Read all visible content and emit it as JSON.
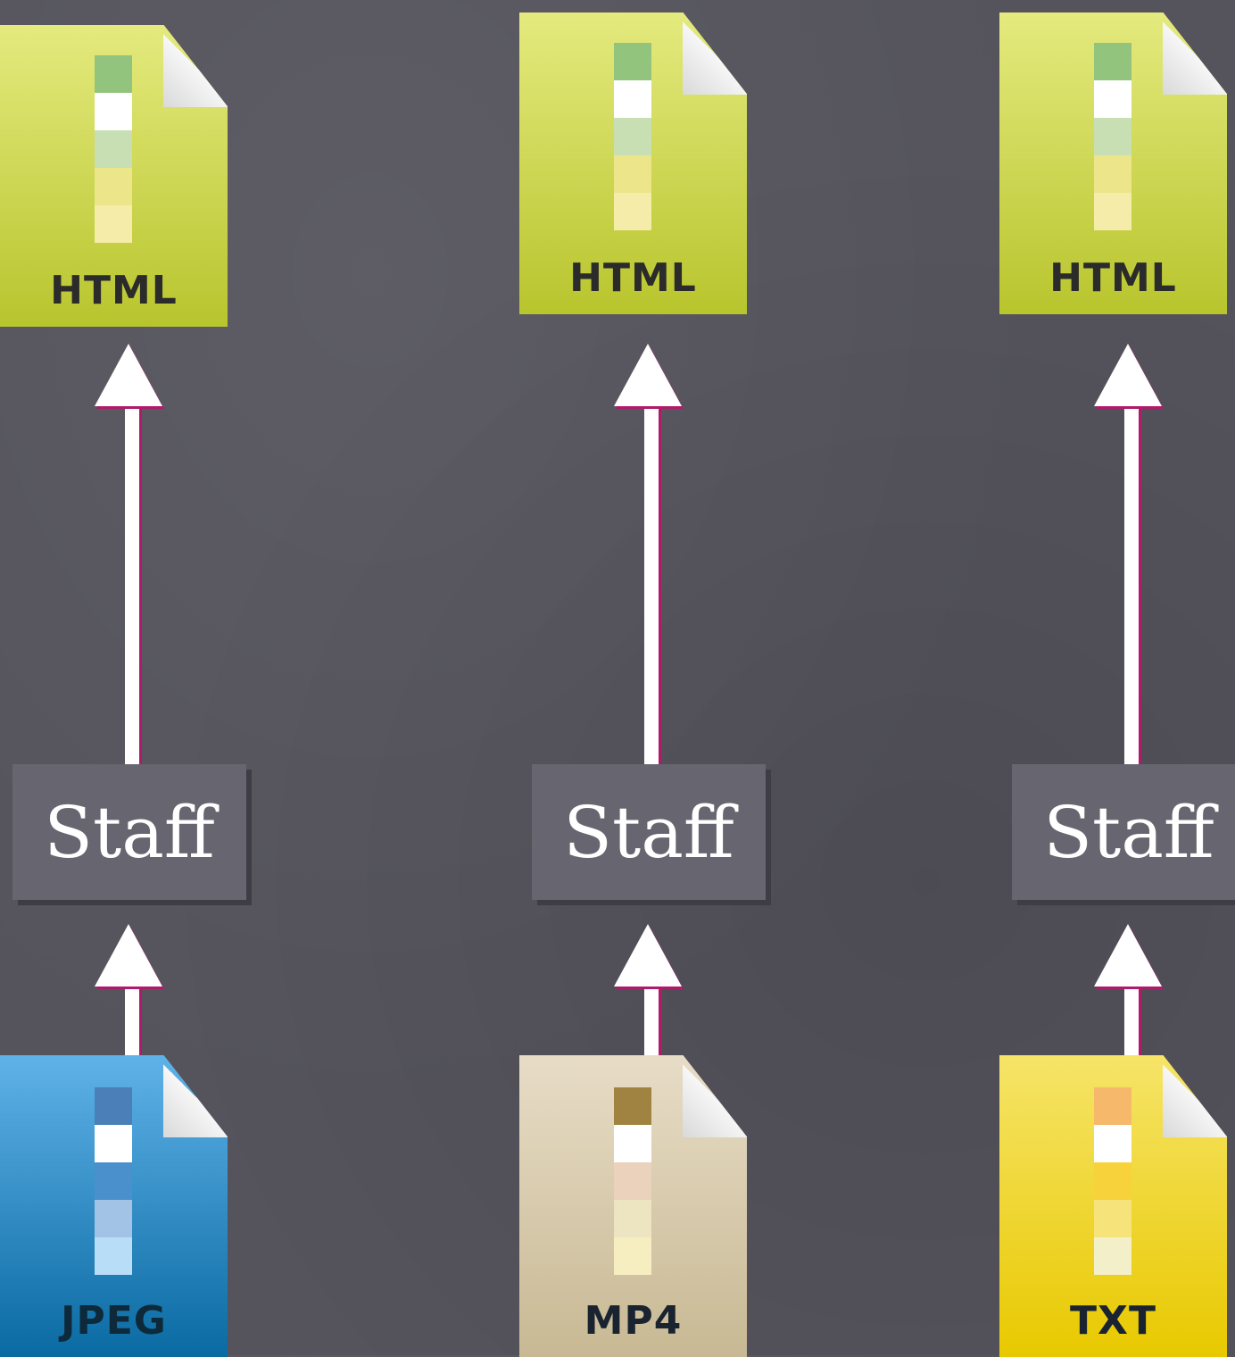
{
  "columns": [
    {
      "top_doc": {
        "label": "HTML",
        "strip_colors": [
          "#93c47d",
          "#ffffff",
          "#c8dfb4",
          "#ede58a",
          "#f5ecaa"
        ]
      },
      "process": {
        "label": "Staff"
      },
      "bottom_doc": {
        "label": "JPEG",
        "strip_colors": [
          "#4a7fb8",
          "#ffffff",
          "#4a90cc",
          "#a3c3e6",
          "#b8ddf6"
        ]
      }
    },
    {
      "top_doc": {
        "label": "HTML",
        "strip_colors": [
          "#93c47d",
          "#ffffff",
          "#c8dfb4",
          "#ede58a",
          "#f5ecaa"
        ]
      },
      "process": {
        "label": "Staff"
      },
      "bottom_doc": {
        "label": "MP4",
        "strip_colors": [
          "#a08340",
          "#ffffff",
          "#ead2bc",
          "#ede4c2",
          "#f6eec0"
        ]
      }
    },
    {
      "top_doc": {
        "label": "HTML",
        "strip_colors": [
          "#93c47d",
          "#ffffff",
          "#c8dfb4",
          "#ede58a",
          "#f5ecaa"
        ]
      },
      "process": {
        "label": "Staff"
      },
      "bottom_doc": {
        "label": "TXT",
        "strip_colors": [
          "#f6b86a",
          "#ffffff",
          "#f8d23a",
          "#f6e47a",
          "#f3efc8"
        ]
      }
    }
  ],
  "colors": {
    "background": "#55545d",
    "arrow": "#ffffff",
    "arrow_shadow": "#b01a6a",
    "process_box": "#67656f"
  }
}
